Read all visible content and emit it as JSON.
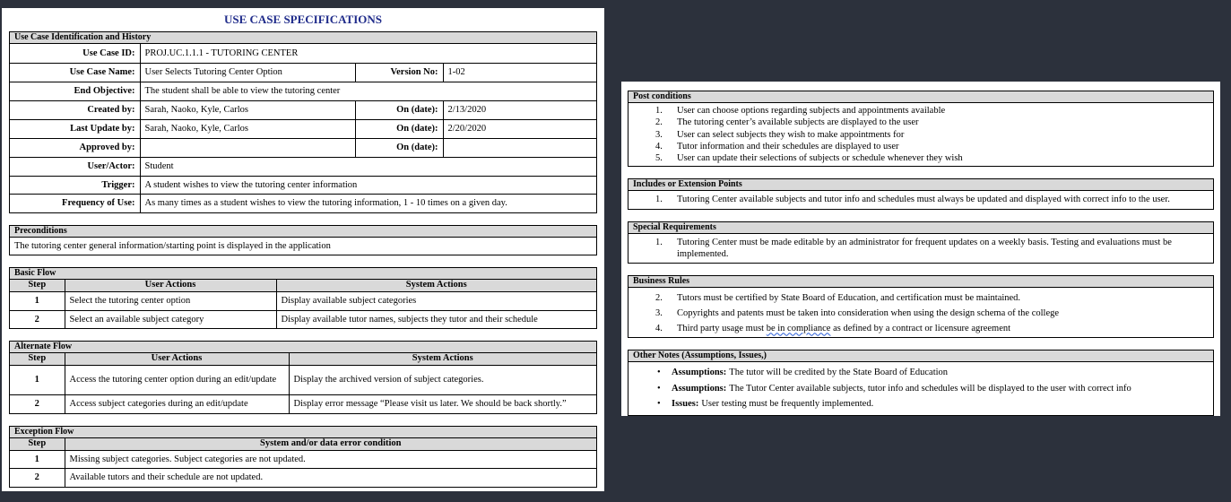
{
  "title": "USE CASE SPECIFICATIONS",
  "identification": {
    "header": "Use Case Identification and History",
    "use_case_id_label": "Use Case ID:",
    "use_case_id": "PROJ.UC.1.1.1 - TUTORING CENTER",
    "use_case_name_label": "Use Case Name:",
    "use_case_name": "User Selects Tutoring Center Option",
    "version_label": "Version No:",
    "version": "1-02",
    "end_objective_label": "End Objective:",
    "end_objective": "The student shall be able to view the tutoring center",
    "created_by_label": "Created by:",
    "created_by": "Sarah, Naoko, Kyle, Carlos",
    "created_on_label": "On (date):",
    "created_on": "2/13/2020",
    "last_update_label": "Last Update by:",
    "last_update_by": "Sarah, Naoko, Kyle, Carlos",
    "last_update_on_label": "On (date):",
    "last_update_on": "2/20/2020",
    "approved_by_label": "Approved by:",
    "approved_by": "",
    "approved_on_label": "On (date):",
    "approved_on": "",
    "actor_label": "User/Actor:",
    "actor": "Student",
    "trigger_label": "Trigger:",
    "trigger": "A student wishes to view the tutoring center information",
    "frequency_label": "Frequency of Use:",
    "frequency": "As many times as a student wishes to view the tutoring information, 1 - 10 times on a given day."
  },
  "preconditions": {
    "header": "Preconditions",
    "text": "The tutoring center general information/starting point is displayed in the application"
  },
  "basic_flow": {
    "header": "Basic Flow",
    "columns": [
      "Step",
      "User Actions",
      "System Actions"
    ],
    "rows": [
      {
        "step": "1",
        "user": "Select the tutoring center option",
        "system": "Display available subject categories"
      },
      {
        "step": "2",
        "user": "Select an available subject category",
        "system": "Display available tutor names, subjects they tutor and their schedule"
      }
    ]
  },
  "alternate_flow": {
    "header": "Alternate Flow",
    "columns": [
      "Step",
      "User Actions",
      "System Actions"
    ],
    "rows": [
      {
        "step": "1",
        "user": "Access the tutoring center option during an edit/update",
        "system": "Display the archived version of subject categories."
      },
      {
        "step": "2",
        "user": "Access subject categories during an edit/update",
        "system": "Display error message “Please visit us later. We should be back shortly.”"
      }
    ]
  },
  "exception_flow": {
    "header": "Exception Flow",
    "columns": [
      "Step",
      "System and/or data error condition"
    ],
    "rows": [
      {
        "step": "1",
        "condition": "Missing subject categories. Subject categories are not updated."
      },
      {
        "step": "2",
        "condition": "Available tutors and their schedule are not updated."
      }
    ]
  },
  "post_conditions": {
    "header": "Post conditions",
    "items": [
      {
        "num": "1.",
        "text": "User can choose options regarding subjects and appointments available"
      },
      {
        "num": "2.",
        "text": "The tutoring center’s available subjects are displayed to the user"
      },
      {
        "num": "3.",
        "text": "User can select subjects they wish to make appointments for"
      },
      {
        "num": "4.",
        "text": "Tutor information and their schedules are displayed to user"
      },
      {
        "num": "5.",
        "text": "User can update their selections of subjects or schedule whenever they wish"
      }
    ]
  },
  "includes": {
    "header": "Includes or Extension Points",
    "items": [
      {
        "num": "1.",
        "text": "Tutoring Center available subjects and tutor info and schedules must always be updated and displayed with correct info to the user."
      }
    ]
  },
  "special_requirements": {
    "header": "Special Requirements",
    "items": [
      {
        "num": "1.",
        "text": "Tutoring Center must be made editable by an administrator for frequent updates on a weekly basis. Testing and evaluations must be implemented."
      }
    ]
  },
  "business_rules": {
    "header": "Business Rules",
    "items": [
      {
        "num": "2.",
        "text": "Tutors must be certified by State Board of Education, and certification must be maintained."
      },
      {
        "num": "3.",
        "text": "Copyrights and patents must be taken into consideration when using the design schema of the college"
      },
      {
        "num": "4.",
        "text_before": "Third party usage must ",
        "text_marked": "be in compliance",
        "text_after": " as defined by a contract or licensure agreement"
      }
    ]
  },
  "other_notes": {
    "header": "Other Notes (Assumptions, Issues,)",
    "items": [
      {
        "bullet": "•",
        "label": "Assumptions:",
        "text": "The tutor will be credited by the State Board of Education"
      },
      {
        "bullet": "•",
        "label": "Assumptions:",
        "text": "The Tutor Center available subjects, tutor info and schedules will be displayed to the user with correct info"
      },
      {
        "bullet": "•",
        "label": "Issues:",
        "text": "User testing must be frequently implemented."
      }
    ]
  }
}
